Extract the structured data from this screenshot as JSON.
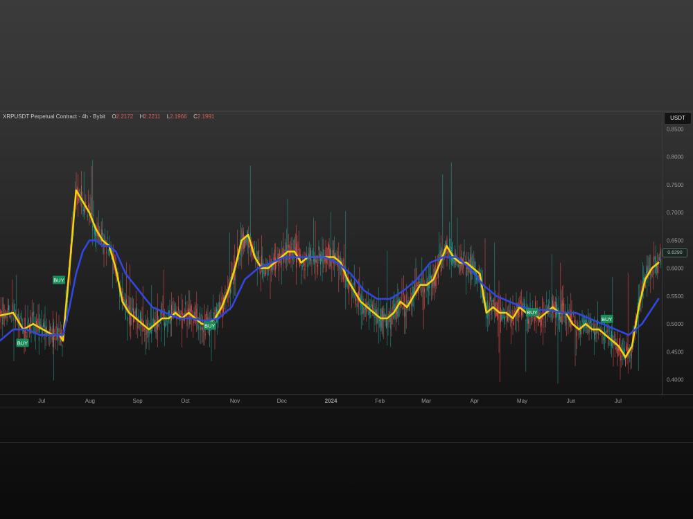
{
  "header": {
    "symbol": "XRPUSDT Perpetual Contract",
    "interval": "4h",
    "exchange": "Bybit",
    "o_label": "O",
    "o_value": "2.2172",
    "h_label": "H",
    "h_value": "2.2211",
    "l_label": "L",
    "l_value": "2.1966",
    "c_label": "C",
    "c_value": "2.1991"
  },
  "currency_button": "USDT",
  "last_price": "0.6290",
  "colors": {
    "fast_ma": "#f5d20c",
    "slow_ma": "#3247e0",
    "buy_badge": "#1a8c5a",
    "candle_up": "#26a69a",
    "candle_down": "#ef5350"
  },
  "chart_data": {
    "type": "line",
    "xlabel": "",
    "ylabel": "",
    "x_ticks": [
      "Jul",
      "Aug",
      "Sep",
      "Oct",
      "Nov",
      "Dec",
      "2024",
      "Feb",
      "Mar",
      "Apr",
      "May",
      "Jun",
      "Jul"
    ],
    "y_ticks": [
      "0.4000",
      "0.4500",
      "0.5000",
      "0.5500",
      "0.6000",
      "0.6500",
      "0.7000",
      "0.7500",
      "0.8000",
      "0.8500"
    ],
    "ylim": [
      0.37,
      0.87
    ],
    "x_range": [
      0,
      100
    ],
    "x_tick_positions": [
      6.3,
      13.6,
      20.8,
      28.0,
      35.5,
      42.6,
      50.0,
      57.4,
      64.4,
      71.7,
      78.9,
      86.3,
      93.4
    ],
    "series": [
      {
        "color": "fast",
        "x": [
          0,
          2,
          3.5,
          5,
          6.5,
          8,
          9,
          9.5,
          10.5,
          11.5,
          12.5,
          13.5,
          14.5,
          15.5,
          16.5,
          17.5,
          18.5,
          19.5,
          20.5,
          21.5,
          22.5,
          23.5,
          24.5,
          25.5,
          26.5,
          27.5,
          28.5,
          29.5,
          30.5,
          31.5,
          32.5,
          33.5,
          34.5,
          35.5,
          36.5,
          37.5,
          38.5,
          39.5,
          40.5,
          41.5,
          42.5,
          43.5,
          44.5,
          45.5,
          46.5,
          47.5,
          48.5,
          49.5,
          50.5,
          51.5,
          52.5,
          53.5,
          54.5,
          55.5,
          56.5,
          57.5,
          58.5,
          59.5,
          60.5,
          61.5,
          62.5,
          63.5,
          64.5,
          65.5,
          66.5,
          67.5,
          68.5,
          69.5,
          70.5,
          71.5,
          72.5,
          73.5,
          74.5,
          75.5,
          76.5,
          77.5,
          78.5,
          79.5,
          80.5,
          81.5,
          82.5,
          83.5,
          84.5,
          85.5,
          86.5,
          87.5,
          88.5,
          89.5,
          90.5,
          91.5,
          92.5,
          93.5,
          94.5,
          95.5,
          96.5,
          97.5,
          98.5,
          99.5
        ],
        "values": [
          0.515,
          0.52,
          0.49,
          0.5,
          0.49,
          0.48,
          0.48,
          0.47,
          0.6,
          0.74,
          0.72,
          0.7,
          0.67,
          0.65,
          0.64,
          0.6,
          0.54,
          0.52,
          0.51,
          0.5,
          0.49,
          0.5,
          0.51,
          0.51,
          0.52,
          0.51,
          0.52,
          0.51,
          0.5,
          0.5,
          0.51,
          0.53,
          0.56,
          0.6,
          0.65,
          0.66,
          0.62,
          0.6,
          0.6,
          0.61,
          0.62,
          0.63,
          0.63,
          0.61,
          0.62,
          0.62,
          0.62,
          0.62,
          0.62,
          0.61,
          0.58,
          0.56,
          0.54,
          0.53,
          0.52,
          0.51,
          0.51,
          0.52,
          0.54,
          0.53,
          0.55,
          0.57,
          0.57,
          0.58,
          0.61,
          0.64,
          0.62,
          0.61,
          0.61,
          0.6,
          0.59,
          0.52,
          0.53,
          0.52,
          0.52,
          0.51,
          0.53,
          0.52,
          0.52,
          0.51,
          0.52,
          0.53,
          0.52,
          0.52,
          0.5,
          0.49,
          0.5,
          0.49,
          0.49,
          0.48,
          0.47,
          0.46,
          0.44,
          0.46,
          0.53,
          0.58,
          0.6,
          0.61
        ]
      },
      {
        "color": "slow",
        "x": [
          0,
          2,
          4,
          6,
          8,
          9.5,
          10.5,
          11.5,
          12.5,
          13.5,
          14.5,
          15.5,
          16.5,
          17.5,
          19,
          21,
          23,
          25,
          27,
          29,
          31,
          33,
          35,
          37,
          39,
          41,
          43,
          45,
          47,
          49,
          51,
          53,
          55,
          57,
          59,
          61,
          63,
          65,
          67,
          69,
          71,
          73,
          75,
          77,
          79,
          81,
          83,
          85,
          87,
          89,
          91,
          93,
          95,
          97,
          99.5
        ],
        "values": [
          0.47,
          0.49,
          0.49,
          0.48,
          0.48,
          0.48,
          0.53,
          0.59,
          0.63,
          0.65,
          0.65,
          0.64,
          0.64,
          0.63,
          0.59,
          0.56,
          0.53,
          0.52,
          0.51,
          0.51,
          0.505,
          0.51,
          0.53,
          0.58,
          0.6,
          0.61,
          0.62,
          0.62,
          0.62,
          0.62,
          0.61,
          0.59,
          0.56,
          0.545,
          0.545,
          0.56,
          0.58,
          0.61,
          0.62,
          0.62,
          0.6,
          0.57,
          0.55,
          0.54,
          0.53,
          0.525,
          0.525,
          0.52,
          0.52,
          0.51,
          0.5,
          0.49,
          0.48,
          0.5,
          0.545
        ]
      }
    ],
    "signals": [
      {
        "label": "BUY",
        "x": 3.4,
        "value": 0.466
      },
      {
        "label": "BUY",
        "x": 8.9,
        "value": 0.579
      },
      {
        "label": "BUY",
        "x": 31.7,
        "value": 0.497
      },
      {
        "label": "BUY",
        "x": 80.4,
        "value": 0.521
      },
      {
        "label": "BUY",
        "x": 91.7,
        "value": 0.509
      }
    ],
    "legend": "none",
    "grid": false
  }
}
